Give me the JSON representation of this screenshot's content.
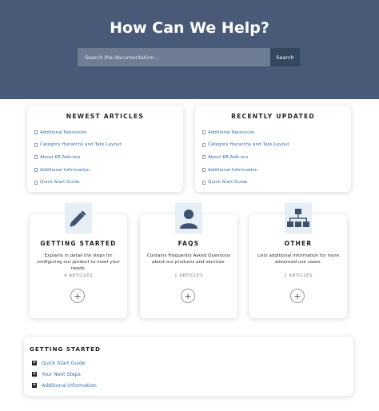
{
  "hero": {
    "title": "How Can We Help?",
    "search_placeholder": "Search the documentation...",
    "search_button": "Search"
  },
  "newest": {
    "heading": "NEWEST ARTICLES",
    "items": [
      "Additional Resources",
      "Category Hierarchy and Tabs Layout",
      "About KB Add-ons",
      "Additional Information",
      "Quick Start Guide"
    ]
  },
  "recent": {
    "heading": "RECENTLY UPDATED",
    "items": [
      "Additional Resources",
      "Category Hierarchy and Tabs Layout",
      "About KB Add-ons",
      "Additional Information",
      "Quick Start Guide"
    ]
  },
  "categories": [
    {
      "title": "GETTING STARTED",
      "desc": "Explains in detail the steps for configuring our product to meet your needs.",
      "count": "4 ARTICLES",
      "icon": "pencil-icon"
    },
    {
      "title": "FAQS",
      "desc": "Contains Frequently Asked Questions about our products and services.",
      "count": "1 ARTICLES",
      "icon": "user-icon"
    },
    {
      "title": "OTHER",
      "desc": "Lists additional information for more advanced use cases.",
      "count": "1 ARTICLES",
      "icon": "sitemap-icon"
    }
  ],
  "getting_started": {
    "title": "GETTING STARTED",
    "items": [
      "Quick Start Guide",
      "Your Next Steps",
      "Additional Information"
    ]
  },
  "colors": {
    "hero_bg": "#485a78",
    "link": "#3a6ea8",
    "icon": "#3e526f",
    "icon_bg": "#e6eef6"
  }
}
